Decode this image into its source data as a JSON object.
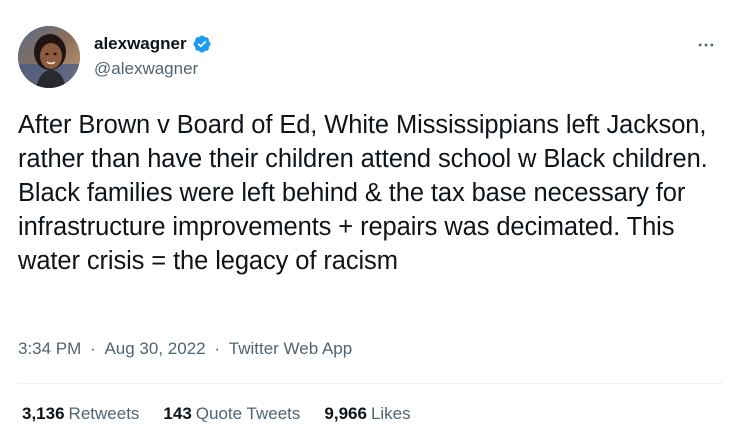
{
  "user": {
    "display_name": "alexwagner",
    "handle": "@alexwagner",
    "verified_icon": "verified-badge-icon",
    "verified_color": "#1d9bf0"
  },
  "tweet": {
    "text": "After Brown v Board of Ed, White Mississippians left Jackson, rather than have their children attend school w Black children. Black families were left behind & the tax base necessary for infrastructure improvements + repairs was decimated. This water crisis = the legacy of racism",
    "time": "3:34 PM",
    "separator": "·",
    "date": "Aug 30, 2022",
    "source": "Twitter Web App"
  },
  "stats": {
    "retweets_count": "3,136",
    "retweets_label": "Retweets",
    "quotes_count": "143",
    "quotes_label": "Quote Tweets",
    "likes_count": "9,966",
    "likes_label": "Likes"
  },
  "icons": {
    "more": "more-horizontal-icon"
  }
}
